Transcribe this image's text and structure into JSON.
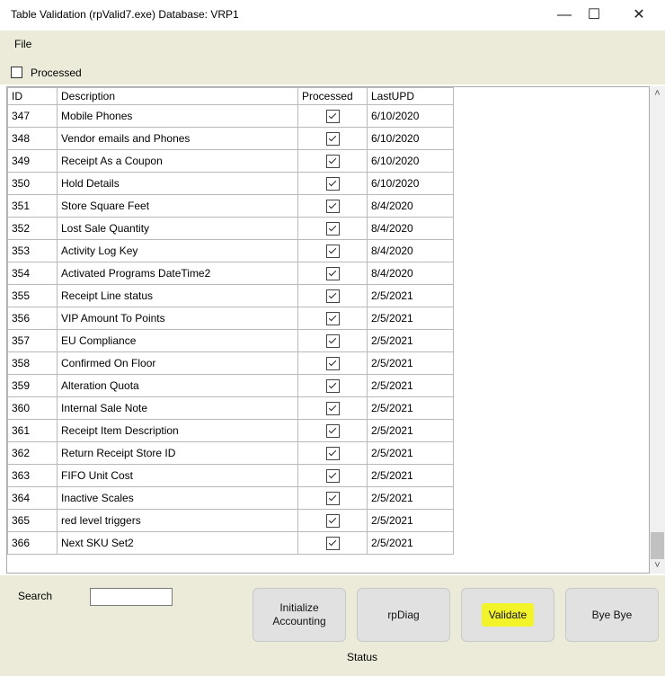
{
  "window": {
    "title": "Table Validation (rpValid7.exe) Database: VRP1",
    "minimize": "—",
    "maximize": "☐",
    "close": "✕"
  },
  "menu": {
    "file": "File"
  },
  "filter": {
    "processed_label": "Processed",
    "processed_checked": false
  },
  "table": {
    "columns": [
      "ID",
      "Description",
      "Processed",
      "LastUPD"
    ],
    "rows": [
      {
        "id": "347",
        "description": "Mobile Phones",
        "processed": true,
        "last_upd": "6/10/2020"
      },
      {
        "id": "348",
        "description": "Vendor emails and Phones",
        "processed": true,
        "last_upd": "6/10/2020"
      },
      {
        "id": "349",
        "description": "Receipt As a Coupon",
        "processed": true,
        "last_upd": "6/10/2020"
      },
      {
        "id": "350",
        "description": "Hold Details",
        "processed": true,
        "last_upd": "6/10/2020"
      },
      {
        "id": "351",
        "description": "Store Square Feet",
        "processed": true,
        "last_upd": "8/4/2020"
      },
      {
        "id": "352",
        "description": "Lost Sale Quantity",
        "processed": true,
        "last_upd": "8/4/2020"
      },
      {
        "id": "353",
        "description": "Activity Log Key",
        "processed": true,
        "last_upd": "8/4/2020"
      },
      {
        "id": "354",
        "description": "Activated Programs DateTime2",
        "processed": true,
        "last_upd": "8/4/2020"
      },
      {
        "id": "355",
        "description": "Receipt Line status",
        "processed": true,
        "last_upd": "2/5/2021"
      },
      {
        "id": "356",
        "description": "VIP Amount To Points",
        "processed": true,
        "last_upd": "2/5/2021"
      },
      {
        "id": "357",
        "description": "EU Compliance",
        "processed": true,
        "last_upd": "2/5/2021"
      },
      {
        "id": "358",
        "description": "Confirmed On Floor",
        "processed": true,
        "last_upd": "2/5/2021"
      },
      {
        "id": "359",
        "description": "Alteration Quota",
        "processed": true,
        "last_upd": "2/5/2021"
      },
      {
        "id": "360",
        "description": "Internal Sale Note",
        "processed": true,
        "last_upd": "2/5/2021"
      },
      {
        "id": "361",
        "description": "Receipt Item Description",
        "processed": true,
        "last_upd": "2/5/2021"
      },
      {
        "id": "362",
        "description": "Return Receipt Store ID",
        "processed": true,
        "last_upd": "2/5/2021"
      },
      {
        "id": "363",
        "description": "FIFO Unit Cost",
        "processed": true,
        "last_upd": "2/5/2021"
      },
      {
        "id": "364",
        "description": "Inactive Scales",
        "processed": true,
        "last_upd": "2/5/2021"
      },
      {
        "id": "365",
        "description": "red level triggers",
        "processed": true,
        "last_upd": "2/5/2021"
      },
      {
        "id": "366",
        "description": "Next SKU Set2",
        "processed": true,
        "last_upd": "2/5/2021"
      }
    ]
  },
  "search": {
    "label": "Search",
    "value": ""
  },
  "buttons": {
    "initialize_line1": "Initialize",
    "initialize_line2": "Accounting",
    "rpdiag": "rpDiag",
    "validate": "Validate",
    "byebye": "Bye Bye"
  },
  "status": "Status",
  "colors": {
    "panel": "#ecebd9",
    "highlight": "#f3f32a",
    "button": "#e1e1e1"
  }
}
